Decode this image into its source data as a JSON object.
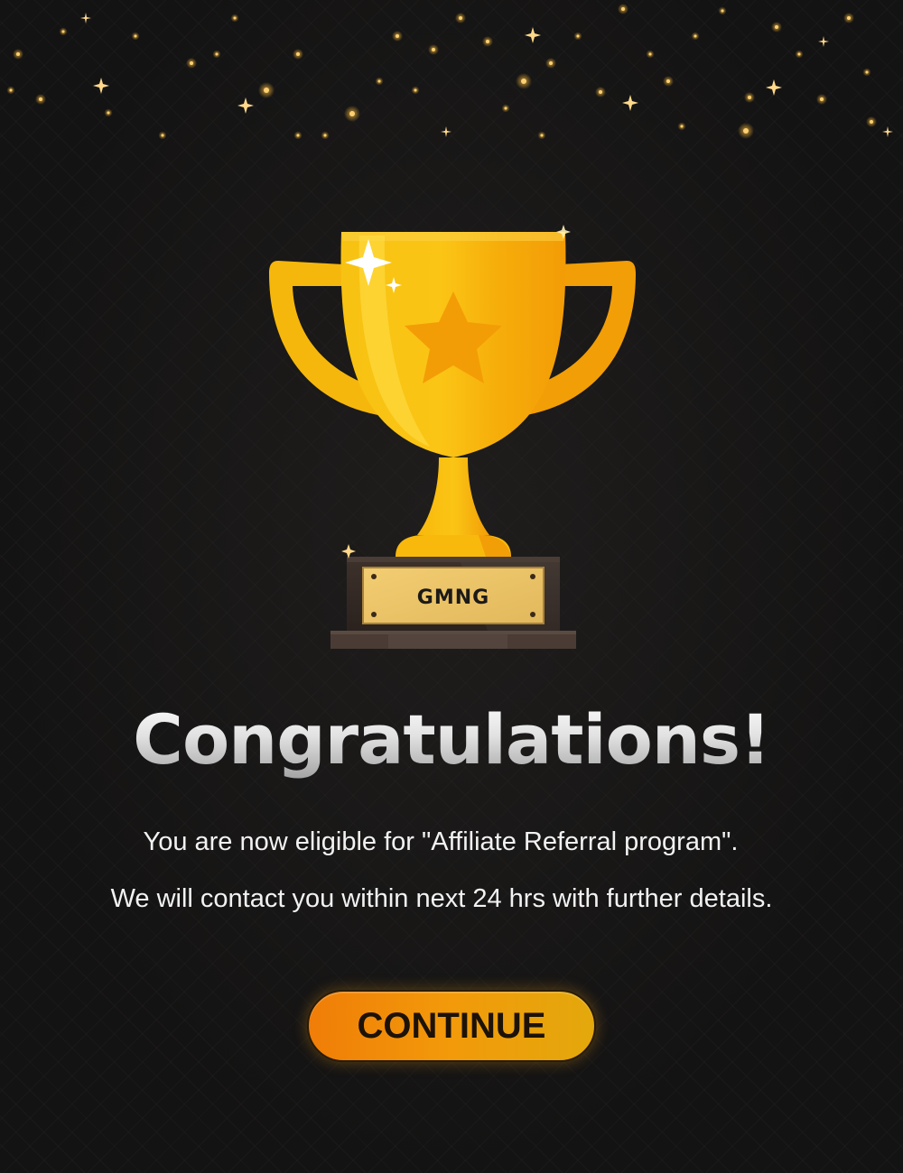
{
  "trophy": {
    "icon": "trophy-icon",
    "plaque_text": "GMNG"
  },
  "headline": "Congratulations!",
  "messages": {
    "line1": "You are now eligible for \"Affiliate Referral program\".",
    "line2": "We will contact you within next 24 hrs with further details."
  },
  "continue_button": {
    "label": "CONTINUE"
  },
  "colors": {
    "background": "#141313",
    "gold": "#f9bf10",
    "gold_dark": "#f29e07",
    "button_start": "#f07d08",
    "button_end": "#e3a80c",
    "plaque": "#ecc26a",
    "base_dark": "#3a2e28"
  }
}
